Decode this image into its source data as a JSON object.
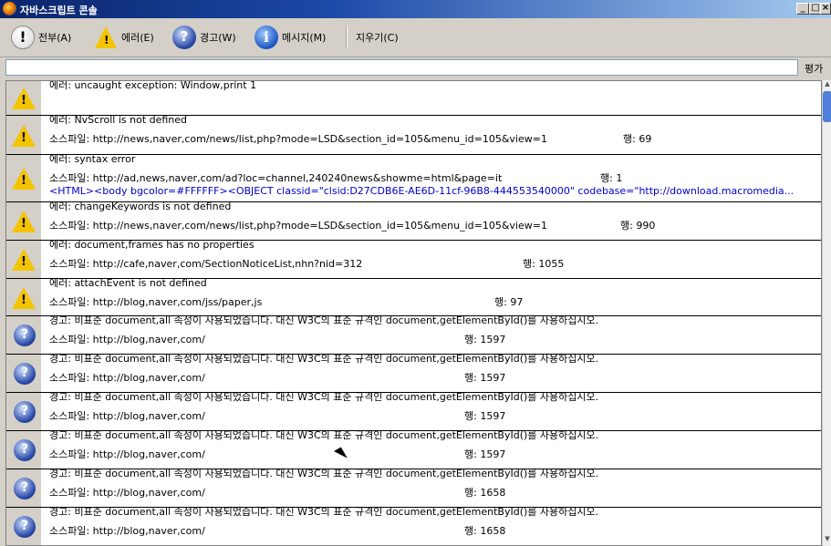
{
  "window": {
    "title": "자바스크립트 콘솔",
    "controls": [
      "_",
      "□",
      "×"
    ]
  },
  "toolbar": {
    "all_label": "전부(A)",
    "errors_label": "에러(E)",
    "warnings_label": "경고(W)",
    "messages_label": "메시지(M)",
    "clear_label": "지우기(C)"
  },
  "eval": {
    "value": "",
    "button_label": "평가"
  },
  "entries": [
    {
      "kind": "error",
      "line1": "에러:  uncaught exception: Window,print 1"
    },
    {
      "kind": "error",
      "line1": "에러:  NvScroll is not defined",
      "source": "소스파일:  http://news,naver,com/news/list,php?mode=LSD&section_id=105&menu_id=105&view=1",
      "line_no": "행:  69"
    },
    {
      "kind": "error",
      "line1": "에러:  syntax error",
      "source": "소스파일:  http://ad,news,naver,com/ad?loc=channel,240240news&showme=html&page=it",
      "line_no": "행:  1",
      "code": "<HTML><body bgcolor=#FFFFFF><OBJECT classid=\"clsid:D27CDB6E-AE6D-11cf-96B8-444553540000\" codebase=\"http://download.macromedia..."
    },
    {
      "kind": "error",
      "line1": "에러:  changeKeywords is not defined",
      "source": "소스파일:  http://news,naver,com/news/list,php?mode=LSD&section_id=105&menu_id=105&view=1",
      "line_no": "행:  990"
    },
    {
      "kind": "error",
      "line1": "에러:  document,frames has no properties",
      "source": "소스파일:  http://cafe,naver,com/SectionNoticeList,nhn?nid=312",
      "line_no": "행:  1055"
    },
    {
      "kind": "error",
      "line1": "에러:  attachEvent is not defined",
      "source": "소스파일:  http://blog,naver,com/jss/paper,js",
      "line_no": "행:  97"
    },
    {
      "kind": "warning",
      "line1": "경고:  비표준 document,all 속성이 사용되었습니다. 대신 W3C의 표준 규격인 document,getElementById()를 사용하십시오.",
      "source": "소스파일:  http://blog,naver,com/",
      "line_no": "행:  1597"
    },
    {
      "kind": "warning",
      "line1": "경고:  비표준 document,all 속성이 사용되었습니다. 대신 W3C의 표준 규격인 document,getElementById()를 사용하십시오.",
      "source": "소스파일:  http://blog,naver,com/",
      "line_no": "행:  1597"
    },
    {
      "kind": "warning",
      "line1": "경고:  비표준 document,all 속성이 사용되었습니다. 대신 W3C의 표준 규격인 document,getElementById()를 사용하십시오.",
      "source": "소스파일:  http://blog,naver,com/",
      "line_no": "행:  1597"
    },
    {
      "kind": "warning",
      "line1": "경고:  비표준 document,all 속성이 사용되었습니다. 대신 W3C의 표준 규격인 document,getElementById()를 사용하십시오.",
      "source": "소스파일:  http://blog,naver,com/",
      "line_no": "행:  1597"
    },
    {
      "kind": "warning",
      "line1": "경고:  비표준 document,all 속성이 사용되었습니다. 대신 W3C의 표준 규격인 document,getElementById()를 사용하십시오.",
      "source": "소스파일:  http://blog,naver,com/",
      "line_no": "행:  1658"
    },
    {
      "kind": "warning",
      "line1": "경고:  비표준 document,all 속성이 사용되었습니다. 대신 W3C의 표준 규격인 document,getElementById()를 사용하십시오.",
      "source": "소스파일:  http://blog,naver,com/",
      "line_no": "행:  1658"
    }
  ]
}
